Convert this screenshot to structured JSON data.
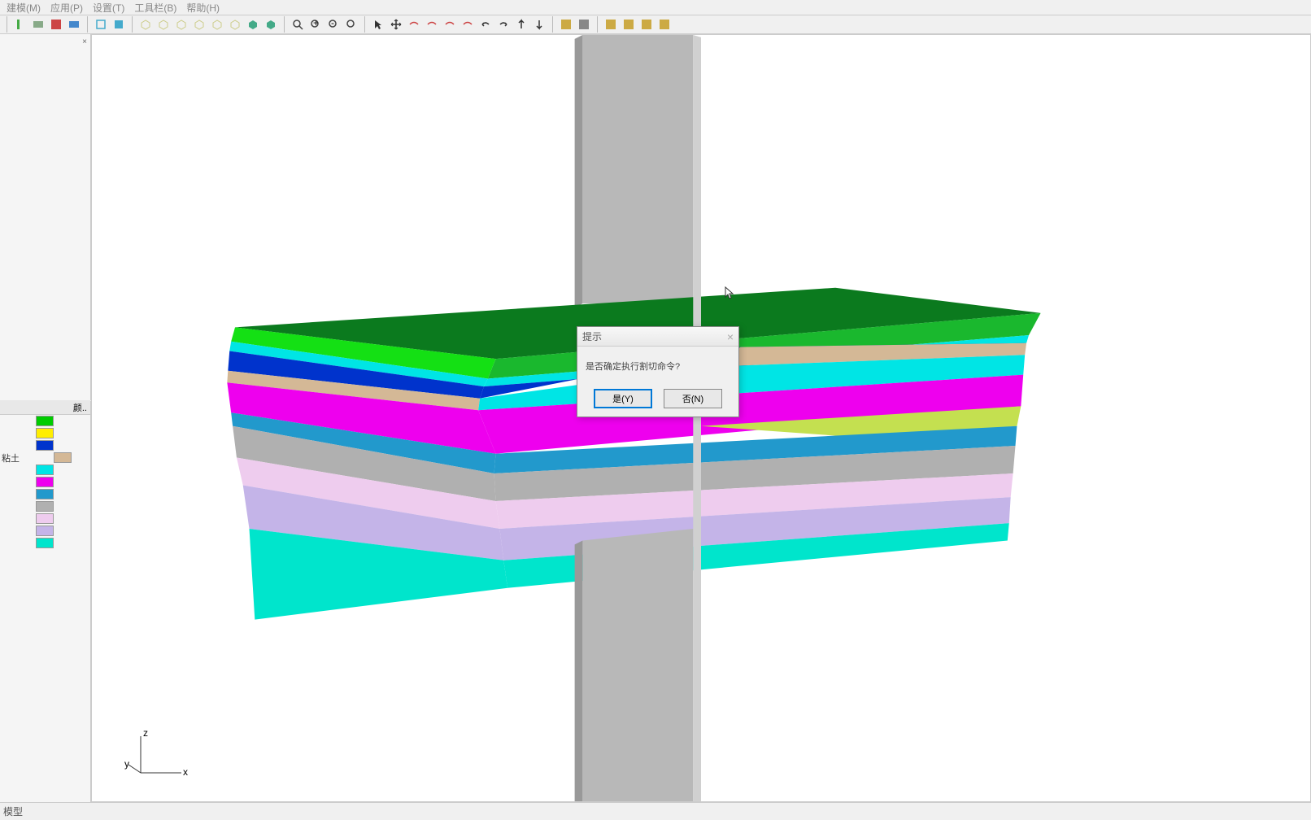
{
  "menu": {
    "items": [
      "建模(M)",
      "应用(P)",
      "设置(T)",
      "工具栏(B)",
      "帮助(H)"
    ]
  },
  "sidebar": {
    "color_header": "颜..",
    "layers": [
      {
        "color": "#00cc00",
        "label": ""
      },
      {
        "color": "#ffee00",
        "label": ""
      },
      {
        "color": "#0033cc",
        "label": ""
      },
      {
        "color": "#d4b896",
        "label": "粘土"
      },
      {
        "color": "#00e5e5",
        "label": ""
      },
      {
        "color": "#ee00ee",
        "label": ""
      },
      {
        "color": "#2299cc",
        "label": ""
      },
      {
        "color": "#b0b0b0",
        "label": ""
      },
      {
        "color": "#eeccee",
        "label": ""
      },
      {
        "color": "#c4b4e8",
        "label": ""
      },
      {
        "color": "#00e5cc",
        "label": ""
      }
    ]
  },
  "dialog": {
    "title": "提示",
    "message": "是否确定执行割切命令?",
    "yes": "是(Y)",
    "no": "否(N)"
  },
  "statusbar": {
    "text": "模型"
  },
  "axes": {
    "x": "x",
    "y": "y",
    "z": "z"
  }
}
